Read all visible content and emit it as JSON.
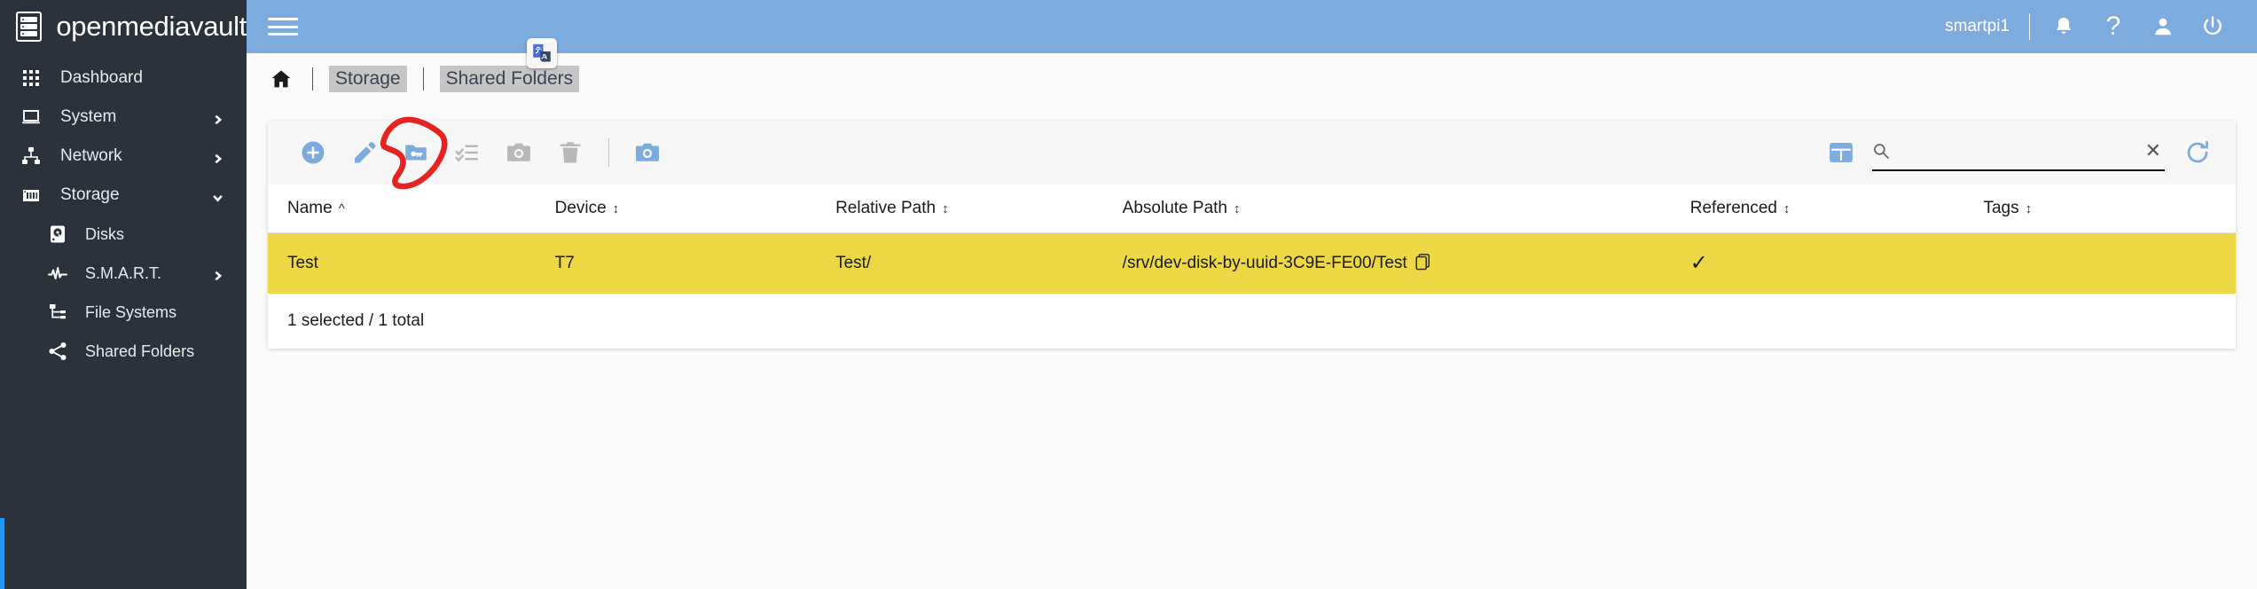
{
  "brand": {
    "name": "openmediavault",
    "logo_icon": "server-stack-icon"
  },
  "sidebar": {
    "items": [
      {
        "label": "Dashboard",
        "icon": "grid-dots-icon",
        "level": "top",
        "chevron": ""
      },
      {
        "label": "System",
        "icon": "laptop-icon",
        "level": "top",
        "chevron": "right"
      },
      {
        "label": "Network",
        "icon": "network-tree-icon",
        "level": "top",
        "chevron": "right"
      },
      {
        "label": "Storage",
        "icon": "storage-bays-icon",
        "level": "top",
        "chevron": "down"
      },
      {
        "label": "Disks",
        "icon": "hard-disk-icon",
        "level": "sub",
        "chevron": ""
      },
      {
        "label": "S.M.A.R.T.",
        "icon": "pulse-icon",
        "level": "sub",
        "chevron": "right"
      },
      {
        "label": "File Systems",
        "icon": "file-tree-icon",
        "level": "sub",
        "chevron": ""
      },
      {
        "label": "Shared Folders",
        "icon": "share-nodes-icon",
        "level": "sub",
        "chevron": ""
      }
    ],
    "background_color": "#2b323b",
    "accent_color": "#2196f3"
  },
  "topbar": {
    "background_color": "#7dabdd",
    "menu_icon": "hamburger-icon",
    "username": "smartpi1",
    "icons": [
      "bell-icon",
      "help-question-icon",
      "user-account-icon",
      "power-icon"
    ]
  },
  "extension_badge": {
    "icon": "google-translate-icon"
  },
  "breadcrumb": {
    "home_icon": "home-icon",
    "crumbs": [
      "Storage",
      "Shared Folders"
    ]
  },
  "toolbar": {
    "buttons": [
      {
        "name": "add",
        "icon": "plus-circle-icon",
        "color": "#7dabdd",
        "enabled": true
      },
      {
        "name": "edit",
        "icon": "pencil-icon",
        "color": "#7dabdd",
        "enabled": true
      },
      {
        "name": "privileges",
        "icon": "folder-key-icon",
        "color": "#7dabdd",
        "enabled": true,
        "annotated": true
      },
      {
        "name": "acl",
        "icon": "checklist-icon",
        "color": "#b8b8b8",
        "enabled": false
      },
      {
        "name": "snapshot",
        "icon": "camera-icon",
        "color": "#b8b8b8",
        "enabled": false
      },
      {
        "name": "delete",
        "icon": "trash-icon",
        "color": "#b8b8b8",
        "enabled": false
      },
      {
        "name": "divider",
        "icon": "",
        "color": "",
        "enabled": false
      },
      {
        "name": "create-snapshot",
        "icon": "camera-icon",
        "color": "#7dabdd",
        "enabled": true
      }
    ],
    "grid_icon": "table-columns-icon",
    "refresh_icon": "refresh-icon",
    "annotation_color": "#e52421"
  },
  "search": {
    "value": "",
    "placeholder": "",
    "search_icon": "magnifier-icon",
    "clear_icon": "close-x-icon"
  },
  "table": {
    "columns": [
      {
        "label": "Name",
        "sort": "asc"
      },
      {
        "label": "Device",
        "sort": "none"
      },
      {
        "label": "Relative Path",
        "sort": "none"
      },
      {
        "label": "Absolute Path",
        "sort": "none"
      },
      {
        "label": "Referenced",
        "sort": "none"
      },
      {
        "label": "Tags",
        "sort": "none"
      }
    ],
    "rows": [
      {
        "name": "Test",
        "device": "T7",
        "relative_path": "Test/",
        "absolute_path": "/srv/dev-disk-by-uuid-3C9E-FE00/Test",
        "referenced": "✓",
        "tags": "",
        "selected": true,
        "copy_icon": "copy-icon"
      }
    ],
    "selected_row_color": "#ecd745",
    "footer_status": "1 selected / 1 total"
  }
}
